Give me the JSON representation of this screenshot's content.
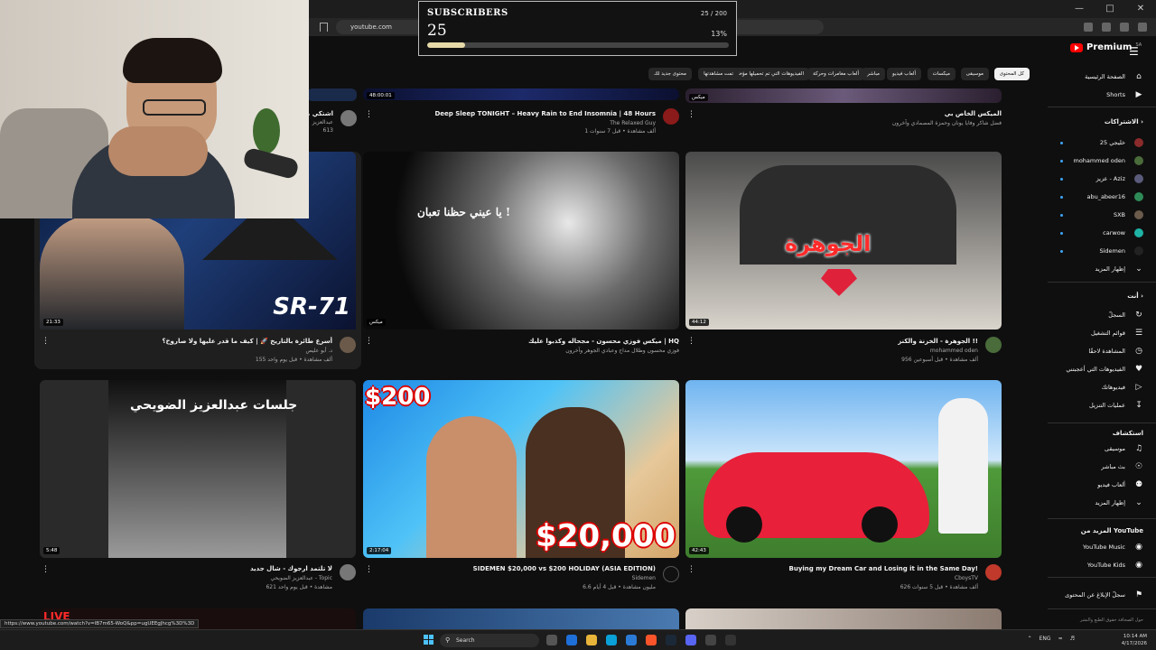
{
  "browser": {
    "url": "youtube.com",
    "status_link": "https://www.youtube.com/watch?v=lB7m65-WoQ&pp=ugUEEgJhcg%3D%3D"
  },
  "subscribers": {
    "title": "SUBSCRIBERS",
    "count": "25",
    "progress": "25 / 200",
    "percent": "13%",
    "fraction": 0.125
  },
  "youtube": {
    "logo": "Premium",
    "region": "SA"
  },
  "chips": [
    "كل المحتوى",
    "موسيقى",
    "ميكسات",
    "ألعاب فيديو",
    "مباشر",
    "ألعاب مغامرات وحركة",
    "الفيديوهات التي تم تحميلها مؤخرًا",
    "تمت مشاهدتها",
    "محتوى جديد لك"
  ],
  "sidebar": {
    "home": "الصفحة الرئيسية",
    "shorts": "Shorts",
    "subscriptions_heading": "الاشتراكات",
    "subscriptions": [
      {
        "name": "خليجي 25",
        "color": "#8b2b2b"
      },
      {
        "name": "mohammed oden",
        "color": "#4a6b3a"
      },
      {
        "name": "عزيز - Aziz",
        "color": "#5a5a7a"
      },
      {
        "name": "abu_abeer16",
        "color": "#2e8b57"
      },
      {
        "name": "SXB",
        "color": "#6b5b4b"
      },
      {
        "name": "carwow",
        "color": "#1fb3a6"
      },
      {
        "name": "Sidemen",
        "color": "#222222"
      }
    ],
    "show_more": "إظهار المزيد",
    "you_heading": "أنت",
    "you_items": [
      "السجلّ",
      "قوائم التشغيل",
      "المشاهدة لاحقًا",
      "الفيديوهات التي أعجبتني",
      "فيديوهاتك",
      "عمليات التنزيل"
    ],
    "explore_heading": "استكشاف",
    "explore_items": [
      "موسيقى",
      "بث مباشر",
      "ألعاب فيديو",
      "إظهار المزيد"
    ],
    "more_heading": "المزيد من YouTube",
    "more_items": [
      "YouTube Music",
      "YouTube Kids"
    ],
    "report": "سجلّ الإبلاغ عن المحتوى",
    "footer": "حول   الصحافة   حقوق الطبع والنشر"
  },
  "top_row": [
    {
      "title": "اشتكي من",
      "channel": "عبدالعزيز",
      "meta": "613",
      "duration": ""
    },
    {
      "title": "Deep Sleep TONIGHT – Heavy Rain to End Insomnia | 48 Hours",
      "channel": "The Relaxed Guy",
      "meta": "1 ألف مشاهدة • قبل 7 سنوات",
      "duration": "48:00:01"
    },
    {
      "title": "الميكس الخاص بي",
      "channel": "فضل شاكر وفايا يونان وحمزة المصمادي وآخرون",
      "meta": "",
      "duration": "ميكس"
    }
  ],
  "videos": [
    {
      "title": "أسرع طائرة بالتاريخ 🚀 | كيف ما قدر عليها ولا صاروخ؟",
      "channel": "د. أبو عليص",
      "meta": "155 ألف مشاهدة • قبل يوم واحد",
      "duration": "21:33",
      "thumb_text": "SR-71",
      "avatar": "#6b5a4a"
    },
    {
      "title": "ميكس فوزي محسون - مجحاله وكذبوا عليك | HQ",
      "channel": "فوزي محسون وطلال مداح وعبادي الجوهر وآخرون",
      "meta": "",
      "duration": "ميكس",
      "thumb_text": "يا عيني حظنا تعبان !",
      "avatar": ""
    },
    {
      "title": "الجوهرة - الخزنة والكنز !!",
      "channel": "mohammed oden",
      "meta": "956 ألف مشاهدة • قبل أسبوعين",
      "duration": "44:12",
      "thumb_text": "الجوهرة",
      "avatar": "#4a6b3a"
    },
    {
      "title": "لا تلتمد ارجوك - شال جديد",
      "channel": "عبدالعزيز الضويحي - Topic",
      "meta": "621 مشاهدة • قبل يوم واحد",
      "duration": "5:48",
      "thumb_text": "جلسات عبدالعزيز الضويحي",
      "avatar": "#777777"
    },
    {
      "title": "SIDEMEN $20,000 vs $200 HOLIDAY (ASIA EDITION)",
      "channel": "Sidemen",
      "meta": "6.6 مليون مشاهدة • قبل 4 أيام",
      "duration": "2:17:04",
      "thumb_text": "$200",
      "thumb_text2": "$20,000",
      "avatar": ""
    },
    {
      "title": "Buying my Dream Car and Losing it in the Same Day!",
      "channel": "CboysTV",
      "meta": "626 ألف مشاهدة • قبل 5 سنوات",
      "duration": "42:43",
      "thumb_text": "",
      "avatar": "#c0392b"
    }
  ],
  "bottom_row": [
    {
      "thumb_text": "LIVE"
    }
  ],
  "taskbar": {
    "search": "Search",
    "lang": "ENG",
    "time": "10:14 AM",
    "date": "4/17/2026"
  },
  "colors": {
    "accent": "#ff0000",
    "bg": "#0f0f0f",
    "link": "#3ea6ff"
  }
}
